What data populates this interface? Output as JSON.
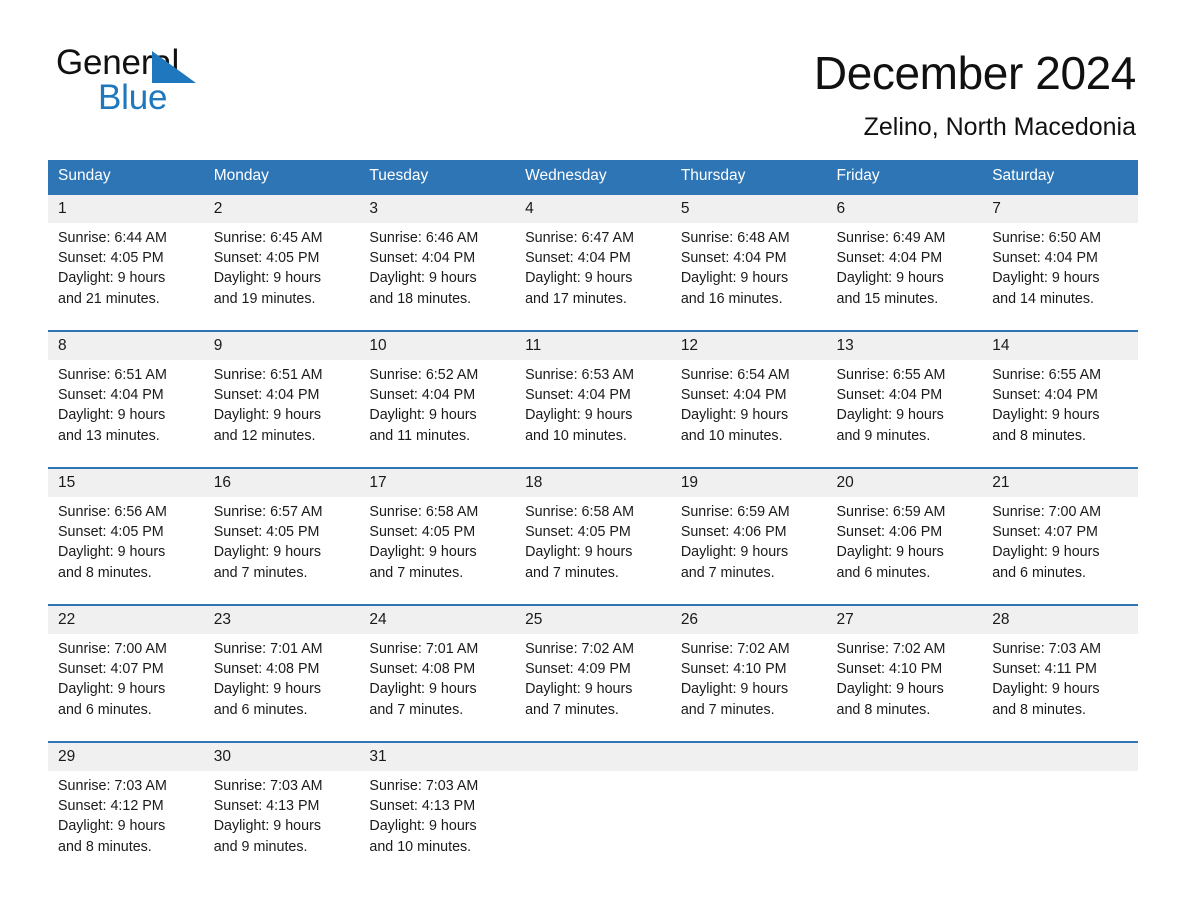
{
  "brand": {
    "name_part1": "General",
    "name_part2": "Blue",
    "triangle_color": "#1f78bd"
  },
  "header": {
    "month_title": "December 2024",
    "location": "Zelino, North Macedonia",
    "header_bg": "#2e75b6",
    "header_text_color": "#ffffff"
  },
  "weekday_headers": [
    "Sunday",
    "Monday",
    "Tuesday",
    "Wednesday",
    "Thursday",
    "Friday",
    "Saturday"
  ],
  "weeks": [
    [
      {
        "day": "1",
        "sunrise": "Sunrise: 6:44 AM",
        "sunset": "Sunset: 4:05 PM",
        "daylight_line1": "Daylight: 9 hours",
        "daylight_line2": "and 21 minutes."
      },
      {
        "day": "2",
        "sunrise": "Sunrise: 6:45 AM",
        "sunset": "Sunset: 4:05 PM",
        "daylight_line1": "Daylight: 9 hours",
        "daylight_line2": "and 19 minutes."
      },
      {
        "day": "3",
        "sunrise": "Sunrise: 6:46 AM",
        "sunset": "Sunset: 4:04 PM",
        "daylight_line1": "Daylight: 9 hours",
        "daylight_line2": "and 18 minutes."
      },
      {
        "day": "4",
        "sunrise": "Sunrise: 6:47 AM",
        "sunset": "Sunset: 4:04 PM",
        "daylight_line1": "Daylight: 9 hours",
        "daylight_line2": "and 17 minutes."
      },
      {
        "day": "5",
        "sunrise": "Sunrise: 6:48 AM",
        "sunset": "Sunset: 4:04 PM",
        "daylight_line1": "Daylight: 9 hours",
        "daylight_line2": "and 16 minutes."
      },
      {
        "day": "6",
        "sunrise": "Sunrise: 6:49 AM",
        "sunset": "Sunset: 4:04 PM",
        "daylight_line1": "Daylight: 9 hours",
        "daylight_line2": "and 15 minutes."
      },
      {
        "day": "7",
        "sunrise": "Sunrise: 6:50 AM",
        "sunset": "Sunset: 4:04 PM",
        "daylight_line1": "Daylight: 9 hours",
        "daylight_line2": "and 14 minutes."
      }
    ],
    [
      {
        "day": "8",
        "sunrise": "Sunrise: 6:51 AM",
        "sunset": "Sunset: 4:04 PM",
        "daylight_line1": "Daylight: 9 hours",
        "daylight_line2": "and 13 minutes."
      },
      {
        "day": "9",
        "sunrise": "Sunrise: 6:51 AM",
        "sunset": "Sunset: 4:04 PM",
        "daylight_line1": "Daylight: 9 hours",
        "daylight_line2": "and 12 minutes."
      },
      {
        "day": "10",
        "sunrise": "Sunrise: 6:52 AM",
        "sunset": "Sunset: 4:04 PM",
        "daylight_line1": "Daylight: 9 hours",
        "daylight_line2": "and 11 minutes."
      },
      {
        "day": "11",
        "sunrise": "Sunrise: 6:53 AM",
        "sunset": "Sunset: 4:04 PM",
        "daylight_line1": "Daylight: 9 hours",
        "daylight_line2": "and 10 minutes."
      },
      {
        "day": "12",
        "sunrise": "Sunrise: 6:54 AM",
        "sunset": "Sunset: 4:04 PM",
        "daylight_line1": "Daylight: 9 hours",
        "daylight_line2": "and 10 minutes."
      },
      {
        "day": "13",
        "sunrise": "Sunrise: 6:55 AM",
        "sunset": "Sunset: 4:04 PM",
        "daylight_line1": "Daylight: 9 hours",
        "daylight_line2": "and 9 minutes."
      },
      {
        "day": "14",
        "sunrise": "Sunrise: 6:55 AM",
        "sunset": "Sunset: 4:04 PM",
        "daylight_line1": "Daylight: 9 hours",
        "daylight_line2": "and 8 minutes."
      }
    ],
    [
      {
        "day": "15",
        "sunrise": "Sunrise: 6:56 AM",
        "sunset": "Sunset: 4:05 PM",
        "daylight_line1": "Daylight: 9 hours",
        "daylight_line2": "and 8 minutes."
      },
      {
        "day": "16",
        "sunrise": "Sunrise: 6:57 AM",
        "sunset": "Sunset: 4:05 PM",
        "daylight_line1": "Daylight: 9 hours",
        "daylight_line2": "and 7 minutes."
      },
      {
        "day": "17",
        "sunrise": "Sunrise: 6:58 AM",
        "sunset": "Sunset: 4:05 PM",
        "daylight_line1": "Daylight: 9 hours",
        "daylight_line2": "and 7 minutes."
      },
      {
        "day": "18",
        "sunrise": "Sunrise: 6:58 AM",
        "sunset": "Sunset: 4:05 PM",
        "daylight_line1": "Daylight: 9 hours",
        "daylight_line2": "and 7 minutes."
      },
      {
        "day": "19",
        "sunrise": "Sunrise: 6:59 AM",
        "sunset": "Sunset: 4:06 PM",
        "daylight_line1": "Daylight: 9 hours",
        "daylight_line2": "and 7 minutes."
      },
      {
        "day": "20",
        "sunrise": "Sunrise: 6:59 AM",
        "sunset": "Sunset: 4:06 PM",
        "daylight_line1": "Daylight: 9 hours",
        "daylight_line2": "and 6 minutes."
      },
      {
        "day": "21",
        "sunrise": "Sunrise: 7:00 AM",
        "sunset": "Sunset: 4:07 PM",
        "daylight_line1": "Daylight: 9 hours",
        "daylight_line2": "and 6 minutes."
      }
    ],
    [
      {
        "day": "22",
        "sunrise": "Sunrise: 7:00 AM",
        "sunset": "Sunset: 4:07 PM",
        "daylight_line1": "Daylight: 9 hours",
        "daylight_line2": "and 6 minutes."
      },
      {
        "day": "23",
        "sunrise": "Sunrise: 7:01 AM",
        "sunset": "Sunset: 4:08 PM",
        "daylight_line1": "Daylight: 9 hours",
        "daylight_line2": "and 6 minutes."
      },
      {
        "day": "24",
        "sunrise": "Sunrise: 7:01 AM",
        "sunset": "Sunset: 4:08 PM",
        "daylight_line1": "Daylight: 9 hours",
        "daylight_line2": "and 7 minutes."
      },
      {
        "day": "25",
        "sunrise": "Sunrise: 7:02 AM",
        "sunset": "Sunset: 4:09 PM",
        "daylight_line1": "Daylight: 9 hours",
        "daylight_line2": "and 7 minutes."
      },
      {
        "day": "26",
        "sunrise": "Sunrise: 7:02 AM",
        "sunset": "Sunset: 4:10 PM",
        "daylight_line1": "Daylight: 9 hours",
        "daylight_line2": "and 7 minutes."
      },
      {
        "day": "27",
        "sunrise": "Sunrise: 7:02 AM",
        "sunset": "Sunset: 4:10 PM",
        "daylight_line1": "Daylight: 9 hours",
        "daylight_line2": "and 8 minutes."
      },
      {
        "day": "28",
        "sunrise": "Sunrise: 7:03 AM",
        "sunset": "Sunset: 4:11 PM",
        "daylight_line1": "Daylight: 9 hours",
        "daylight_line2": "and 8 minutes."
      }
    ],
    [
      {
        "day": "29",
        "sunrise": "Sunrise: 7:03 AM",
        "sunset": "Sunset: 4:12 PM",
        "daylight_line1": "Daylight: 9 hours",
        "daylight_line2": "and 8 minutes."
      },
      {
        "day": "30",
        "sunrise": "Sunrise: 7:03 AM",
        "sunset": "Sunset: 4:13 PM",
        "daylight_line1": "Daylight: 9 hours",
        "daylight_line2": "and 9 minutes."
      },
      {
        "day": "31",
        "sunrise": "Sunrise: 7:03 AM",
        "sunset": "Sunset: 4:13 PM",
        "daylight_line1": "Daylight: 9 hours",
        "daylight_line2": "and 10 minutes."
      },
      {
        "day": "",
        "sunrise": "",
        "sunset": "",
        "daylight_line1": "",
        "daylight_line2": ""
      },
      {
        "day": "",
        "sunrise": "",
        "sunset": "",
        "daylight_line1": "",
        "daylight_line2": ""
      },
      {
        "day": "",
        "sunrise": "",
        "sunset": "",
        "daylight_line1": "",
        "daylight_line2": ""
      },
      {
        "day": "",
        "sunrise": "",
        "sunset": "",
        "daylight_line1": "",
        "daylight_line2": ""
      }
    ]
  ]
}
